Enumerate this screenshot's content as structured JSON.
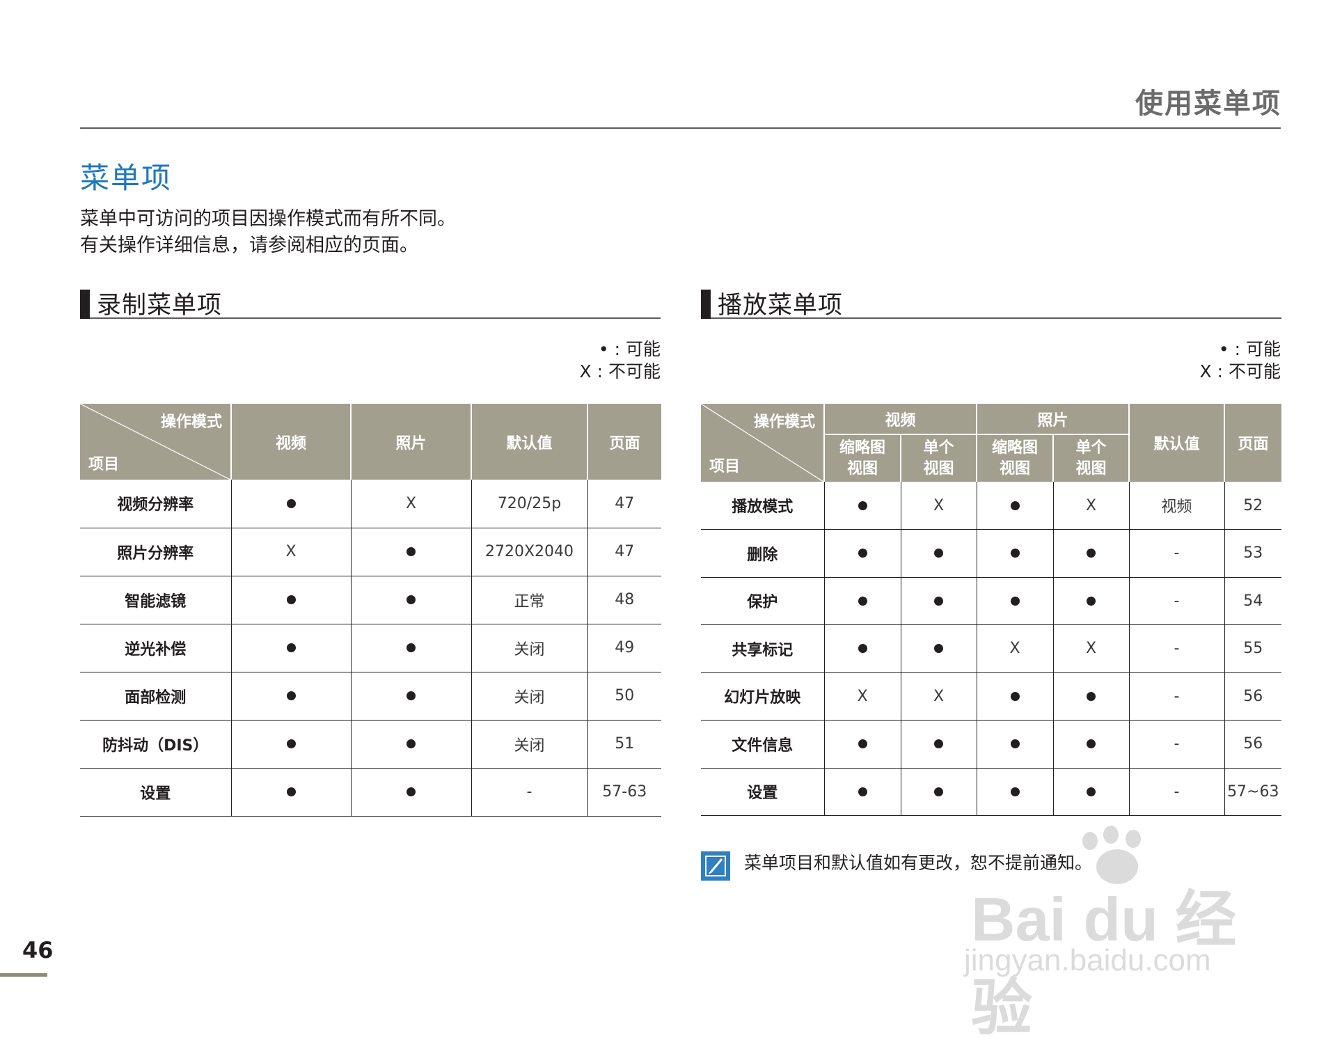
{
  "header": {
    "chapter_title": "使用菜单项"
  },
  "section": {
    "title": "菜单项",
    "intro": [
      "菜单中可访问的项目因操作模式而有所不同。",
      "有关操作详细信息，请参阅相应的页面。"
    ]
  },
  "legend": {
    "possible": "• : 可能",
    "impossible": "X : 不可能"
  },
  "recording": {
    "title": "录制菜单项",
    "header": {
      "mode": "操作模式",
      "item": "项目",
      "video": "视频",
      "photo": "照片",
      "default": "默认值",
      "page": "页面"
    },
    "rows": [
      {
        "item": "视频分辨率",
        "video": "●",
        "photo": "X",
        "default": "720/25p",
        "page": "47"
      },
      {
        "item": "照片分辨率",
        "video": "X",
        "photo": "●",
        "default": "2720X2040",
        "page": "47"
      },
      {
        "item": "智能滤镜",
        "video": "●",
        "photo": "●",
        "default": "正常",
        "page": "48"
      },
      {
        "item": "逆光补偿",
        "video": "●",
        "photo": "●",
        "default": "关闭",
        "page": "49"
      },
      {
        "item": "面部检测",
        "video": "●",
        "photo": "●",
        "default": "关闭",
        "page": "50"
      },
      {
        "item": "防抖动（DIS）",
        "video": "●",
        "photo": "●",
        "default": "关闭",
        "page": "51"
      },
      {
        "item": "设置",
        "video": "●",
        "photo": "●",
        "default": "-",
        "page": "57-63"
      }
    ]
  },
  "playback": {
    "title": "播放菜单项",
    "header": {
      "mode": "操作模式",
      "item": "项目",
      "video": "视频",
      "photo": "照片",
      "thumb": "缩略图视图",
      "single": "单个视图",
      "thumb_l1": "缩略图",
      "thumb_l2": "视图",
      "single_l1": "单个",
      "single_l2": "视图",
      "default": "默认值",
      "page": "页面"
    },
    "rows": [
      {
        "item": "播放模式",
        "v_thumb": "●",
        "v_single": "X",
        "p_thumb": "●",
        "p_single": "X",
        "default": "视频",
        "page": "52"
      },
      {
        "item": "删除",
        "v_thumb": "●",
        "v_single": "●",
        "p_thumb": "●",
        "p_single": "●",
        "default": "-",
        "page": "53"
      },
      {
        "item": "保护",
        "v_thumb": "●",
        "v_single": "●",
        "p_thumb": "●",
        "p_single": "●",
        "default": "-",
        "page": "54"
      },
      {
        "item": "共享标记",
        "v_thumb": "●",
        "v_single": "●",
        "p_thumb": "X",
        "p_single": "X",
        "default": "-",
        "page": "55"
      },
      {
        "item": "幻灯片放映",
        "v_thumb": "X",
        "v_single": "X",
        "p_thumb": "●",
        "p_single": "●",
        "default": "-",
        "page": "56"
      },
      {
        "item": "文件信息",
        "v_thumb": "●",
        "v_single": "●",
        "p_thumb": "●",
        "p_single": "●",
        "default": "-",
        "page": "56"
      },
      {
        "item": "设置",
        "v_thumb": "●",
        "v_single": "●",
        "p_thumb": "●",
        "p_single": "●",
        "default": "-",
        "page": "57~63"
      }
    ]
  },
  "note": {
    "icon": "note-pencil-icon",
    "text": "菜单项目和默认值如有更改，恕不提前通知。"
  },
  "watermark": {
    "brand": "Bai du 经验",
    "url": "jingyan.baidu.com"
  },
  "page_number": "46",
  "colors": {
    "header_bg": "#a29f8f",
    "title_blue": "#1f78b8",
    "note_icon": "#2f7fc1"
  }
}
